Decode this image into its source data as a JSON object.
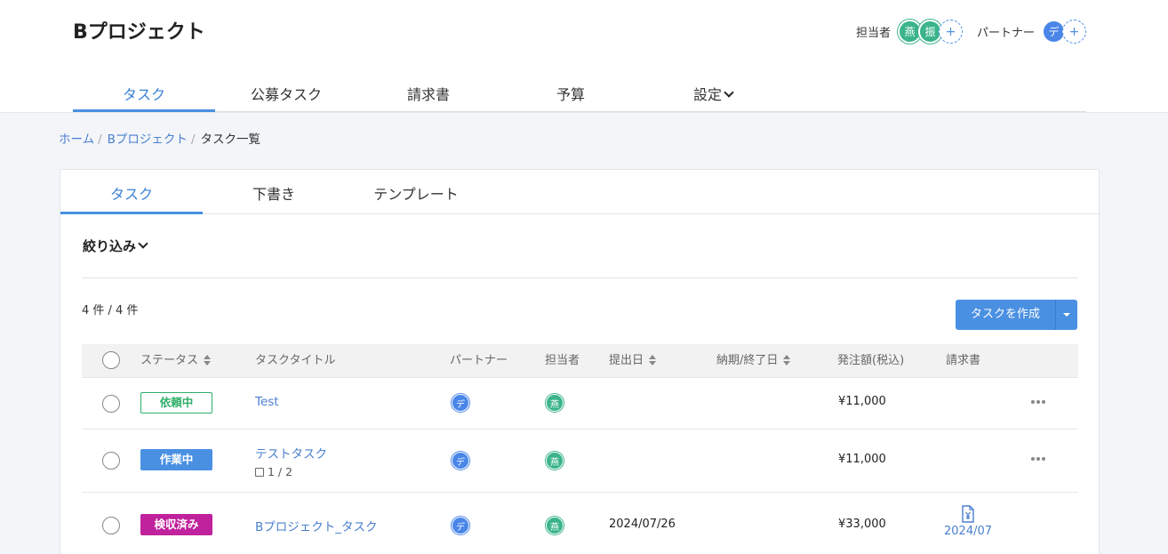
{
  "project_title": "Bプロジェクト",
  "header": {
    "assignee_label": "担当者",
    "assignees": [
      "燕",
      "振"
    ],
    "partner_label": "パートナー",
    "partners": [
      "デ"
    ],
    "add_symbol": "+"
  },
  "main_nav": [
    "タスク",
    "公募タスク",
    "請求書",
    "予算",
    "設定"
  ],
  "breadcrumb": {
    "home": "ホーム",
    "project": "Bプロジェクト",
    "current": "タスク一覧",
    "separator": "/"
  },
  "sub_tabs": [
    "タスク",
    "下書き",
    "テンプレート"
  ],
  "filter_label": "絞り込み",
  "count_text": "4 件 / 4 件",
  "create_button": "タスクを作成",
  "table": {
    "headers": {
      "status": "ステータス",
      "title": "タスクタイトル",
      "partner": "パートナー",
      "assignee": "担当者",
      "submitted": "提出日",
      "due": "納期/終了日",
      "amount": "発注額(税込)",
      "invoice": "請求書"
    },
    "rows": [
      {
        "status": "依頼中",
        "title": "Test",
        "subtasks": "",
        "partner": "デ",
        "assignee": "燕",
        "submitted": "",
        "amount": "¥11,000",
        "invoice": ""
      },
      {
        "status": "作業中",
        "title": "テストタスク",
        "subtasks": "1 / 2",
        "partner": "デ",
        "assignee": "燕",
        "submitted": "",
        "amount": "¥11,000",
        "invoice": ""
      },
      {
        "status": "検収済み",
        "title": "Bプロジェクト_タスク",
        "subtasks": "",
        "partner": "デ",
        "assignee": "燕",
        "submitted": "2024/07/26",
        "amount": "¥33,000",
        "invoice": "2024/07"
      }
    ]
  },
  "colors": {
    "accent": "#4a90e2",
    "status_requested": "#2fae6a",
    "status_working": "#4a90e2",
    "status_accepted": "#c0219c",
    "avatar_green": "#3bb48a",
    "avatar_blue": "#4a86e8"
  }
}
